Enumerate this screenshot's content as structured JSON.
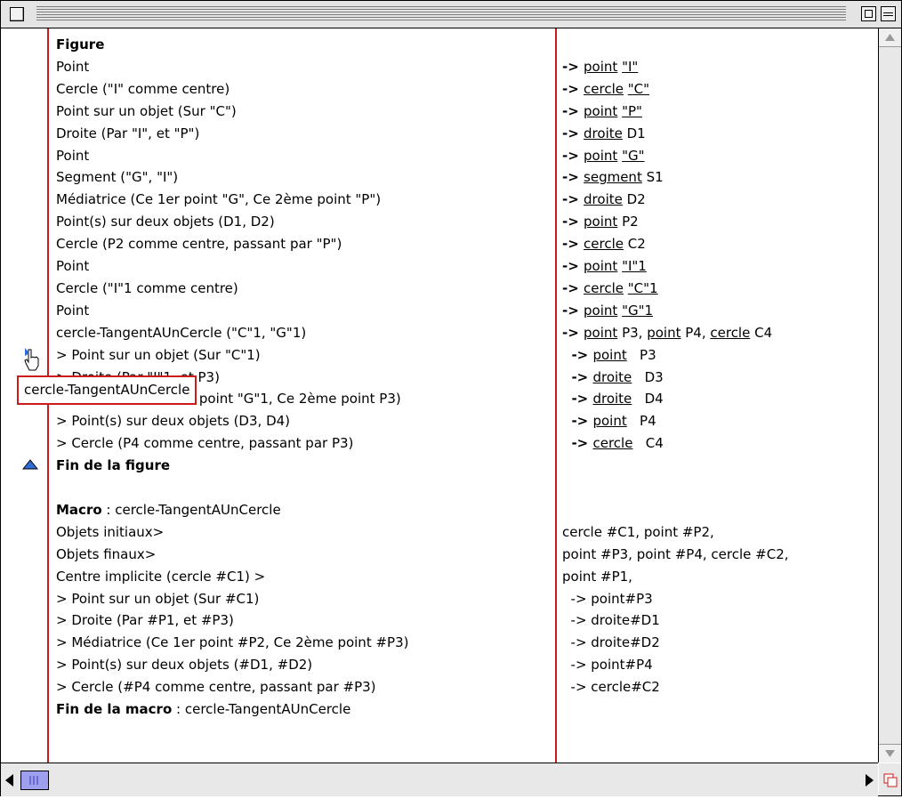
{
  "left_lines": [
    {
      "text": "Figure",
      "bold": true
    },
    {
      "text": "Point"
    },
    {
      "text": "Cercle (\"I\" comme centre)"
    },
    {
      "text": "Point sur un objet (Sur \"C\")"
    },
    {
      "text": "Droite (Par \"I\", et \"P\")"
    },
    {
      "text": "Point"
    },
    {
      "text": "Segment (\"G\", \"I\")"
    },
    {
      "text": "Médiatrice (Ce 1er point \"G\", Ce 2ème point \"P\")"
    },
    {
      "text": "Point(s) sur deux objets (D1, D2)"
    },
    {
      "text": "Cercle (P2 comme centre, passant par \"P\")"
    },
    {
      "text": "Point"
    },
    {
      "text": "Cercle (\"I\"1 comme centre)"
    },
    {
      "text": "Point"
    },
    {
      "text": "cercle-TangentAUnCercle (\"C\"1, \"G\"1)"
    },
    {
      "text": "> Point sur un objet (Sur \"C\"1)"
    },
    {
      "text": "> Droite (Par \"I\"1, et P3)"
    },
    {
      "text": "> Médiatrice (Ce 1er point \"G\"1, Ce 2ème point P3)"
    },
    {
      "text": "> Point(s) sur deux objets (D3, D4)"
    },
    {
      "text": "> Cercle (P4 comme centre, passant par P3)"
    },
    {
      "text": "Fin de la figure",
      "bold": true
    },
    {
      "text": ""
    },
    {
      "label": "Macro",
      "text": " : cercle-TangentAUnCercle"
    },
    {
      "text": "Objets initiaux>"
    },
    {
      "text": "Objets finaux>"
    },
    {
      "text": "Centre implicite (cercle #C1) >"
    },
    {
      "text": "> Point sur un objet (Sur #C1)"
    },
    {
      "text": "> Droite (Par #P1, et #P3)"
    },
    {
      "text": "> Médiatrice (Ce 1er point #P2, Ce 2ème point #P3)"
    },
    {
      "text": "> Point(s) sur deux objets (#D1, #D2)"
    },
    {
      "text": "> Cercle (#P4 comme centre, passant par #P3)"
    },
    {
      "label": "Fin de la macro",
      "text": " : cercle-TangentAUnCercle"
    }
  ],
  "right_lines": [
    {
      "text": ""
    },
    {
      "arrow": "->",
      "parts": [
        {
          "t": "point",
          "u": true
        },
        {
          "t": " "
        },
        {
          "t": "\"I\"",
          "u": true
        }
      ]
    },
    {
      "arrow": "->",
      "parts": [
        {
          "t": "cercle",
          "u": true
        },
        {
          "t": " "
        },
        {
          "t": "\"C\"",
          "u": true
        }
      ]
    },
    {
      "arrow": "->",
      "parts": [
        {
          "t": "point",
          "u": true
        },
        {
          "t": " "
        },
        {
          "t": "\"P\"",
          "u": true
        }
      ]
    },
    {
      "arrow": "->",
      "parts": [
        {
          "t": "droite",
          "u": true
        },
        {
          "t": " D1"
        }
      ]
    },
    {
      "arrow": "->",
      "parts": [
        {
          "t": "point",
          "u": true
        },
        {
          "t": " "
        },
        {
          "t": "\"G\"",
          "u": true
        }
      ]
    },
    {
      "arrow": "->",
      "parts": [
        {
          "t": "segment",
          "u": true
        },
        {
          "t": " S1"
        }
      ]
    },
    {
      "arrow": "->",
      "parts": [
        {
          "t": "droite",
          "u": true
        },
        {
          "t": " D2"
        }
      ]
    },
    {
      "arrow": "->",
      "parts": [
        {
          "t": "point",
          "u": true
        },
        {
          "t": " P2"
        }
      ]
    },
    {
      "arrow": "->",
      "parts": [
        {
          "t": "cercle",
          "u": true
        },
        {
          "t": " C2"
        }
      ]
    },
    {
      "arrow": "->",
      "parts": [
        {
          "t": "point",
          "u": true
        },
        {
          "t": " "
        },
        {
          "t": "\"I\"1",
          "u": true
        }
      ]
    },
    {
      "arrow": "->",
      "parts": [
        {
          "t": "cercle",
          "u": true
        },
        {
          "t": " "
        },
        {
          "t": "\"C\"1",
          "u": true
        }
      ]
    },
    {
      "arrow": "->",
      "parts": [
        {
          "t": "point",
          "u": true
        },
        {
          "t": " "
        },
        {
          "t": "\"G\"1",
          "u": true
        }
      ]
    },
    {
      "arrow": "->",
      "parts": [
        {
          "t": "point",
          "u": true
        },
        {
          "t": " P3, "
        },
        {
          "t": "point",
          "u": true
        },
        {
          "t": " P4, "
        },
        {
          "t": "cercle",
          "u": true
        },
        {
          "t": " C4"
        }
      ]
    },
    {
      "arrow": "  ->",
      "parts": [
        {
          "t": "point",
          "u": true
        },
        {
          "t": "   P3"
        }
      ]
    },
    {
      "arrow": "  ->",
      "parts": [
        {
          "t": "droite",
          "u": true
        },
        {
          "t": "   D3"
        }
      ]
    },
    {
      "arrow": "  ->",
      "parts": [
        {
          "t": "droite",
          "u": true
        },
        {
          "t": "   D4"
        }
      ]
    },
    {
      "arrow": "  ->",
      "parts": [
        {
          "t": "point",
          "u": true
        },
        {
          "t": "   P4"
        }
      ]
    },
    {
      "arrow": "  ->",
      "parts": [
        {
          "t": "cercle",
          "u": true
        },
        {
          "t": "   C4"
        }
      ]
    },
    {
      "text": ""
    },
    {
      "text": ""
    },
    {
      "text": ""
    },
    {
      "text": "cercle #C1, point #P2,"
    },
    {
      "text": "point #P3, point #P4, cercle #C2,"
    },
    {
      "text": "point #P1,"
    },
    {
      "text": "  -> point#P3"
    },
    {
      "text": "  -> droite#D1"
    },
    {
      "text": "  -> droite#D2"
    },
    {
      "text": "  -> point#P4"
    },
    {
      "text": "  -> cercle#C2"
    },
    {
      "text": ""
    }
  ],
  "tooltip": "cercle-TangentAUnCercle",
  "icons": [
    "cursor-hand-icon",
    "up-triangle-icon",
    "scroll-up-arrow-icon",
    "scroll-down-arrow-icon",
    "scroll-left-arrow-icon",
    "scroll-right-arrow-icon",
    "grow-box-icon"
  ]
}
